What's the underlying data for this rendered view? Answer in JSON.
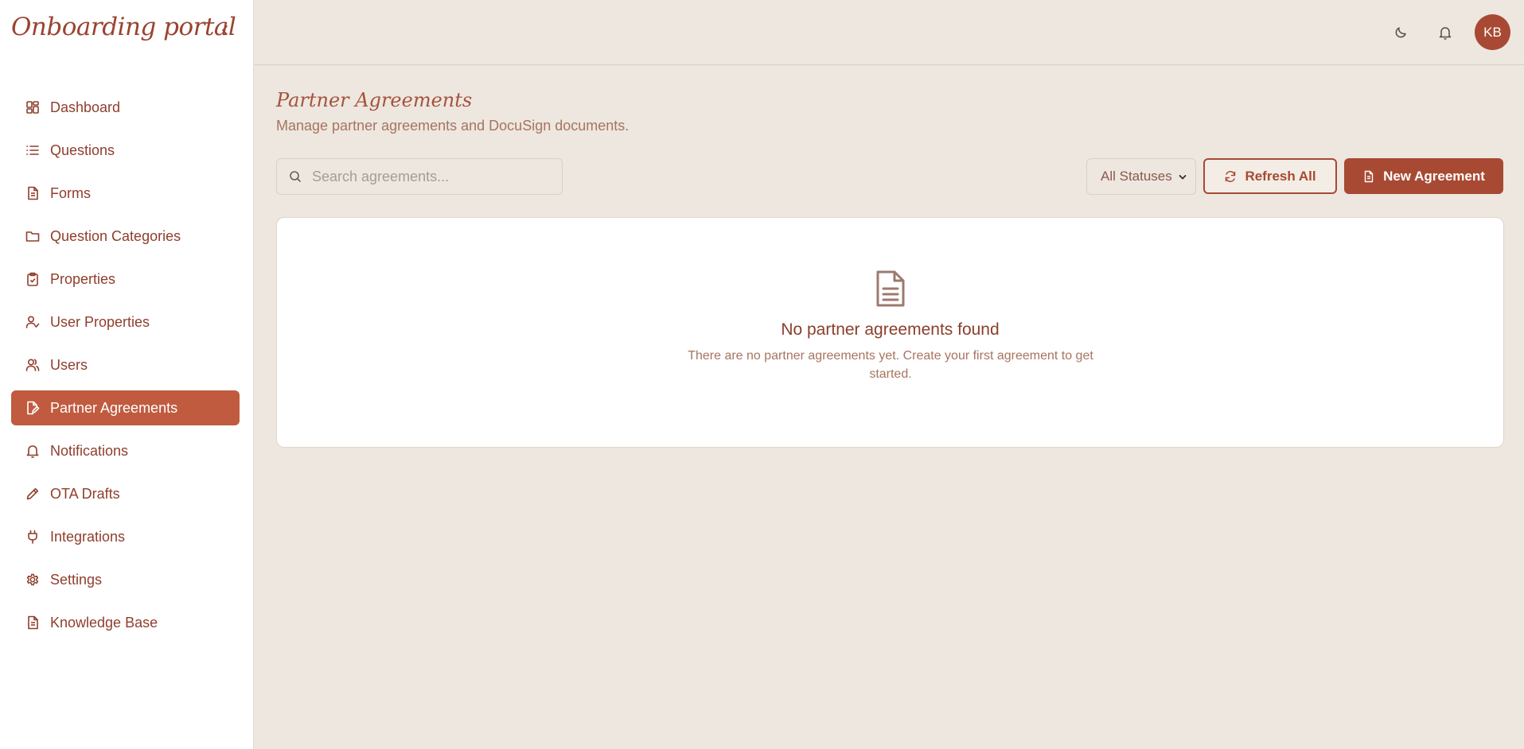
{
  "app": {
    "title": "Onboarding portal"
  },
  "sidebar": {
    "items": [
      {
        "label": "Dashboard",
        "icon": "dashboard-icon"
      },
      {
        "label": "Questions",
        "icon": "list-icon"
      },
      {
        "label": "Forms",
        "icon": "document-icon"
      },
      {
        "label": "Question Categories",
        "icon": "folder-icon"
      },
      {
        "label": "Properties",
        "icon": "clipboard-check-icon"
      },
      {
        "label": "User Properties",
        "icon": "user-check-icon"
      },
      {
        "label": "Users",
        "icon": "users-icon"
      },
      {
        "label": "Partner Agreements",
        "icon": "file-edit-icon",
        "active": true
      },
      {
        "label": "Notifications",
        "icon": "bell-icon"
      },
      {
        "label": "OTA Drafts",
        "icon": "pencil-icon"
      },
      {
        "label": "Integrations",
        "icon": "plug-icon"
      },
      {
        "label": "Settings",
        "icon": "gear-icon"
      },
      {
        "label": "Knowledge Base",
        "icon": "document-icon"
      }
    ]
  },
  "header": {
    "avatar_initials": "KB"
  },
  "main": {
    "title": "Partner Agreements",
    "subtitle": "Manage partner agreements and DocuSign documents.",
    "search": {
      "placeholder": "Search agreements...",
      "value": ""
    },
    "status_filter": {
      "selected": "All Statuses"
    },
    "refresh_label": "Refresh All",
    "new_label": "New Agreement",
    "empty": {
      "title": "No partner agreements found",
      "text": "There are no partner agreements yet. Create your first agreement to get started."
    }
  },
  "colors": {
    "accent": "#a84a33",
    "active_nav": "#c05b40",
    "background": "#ede7df"
  }
}
